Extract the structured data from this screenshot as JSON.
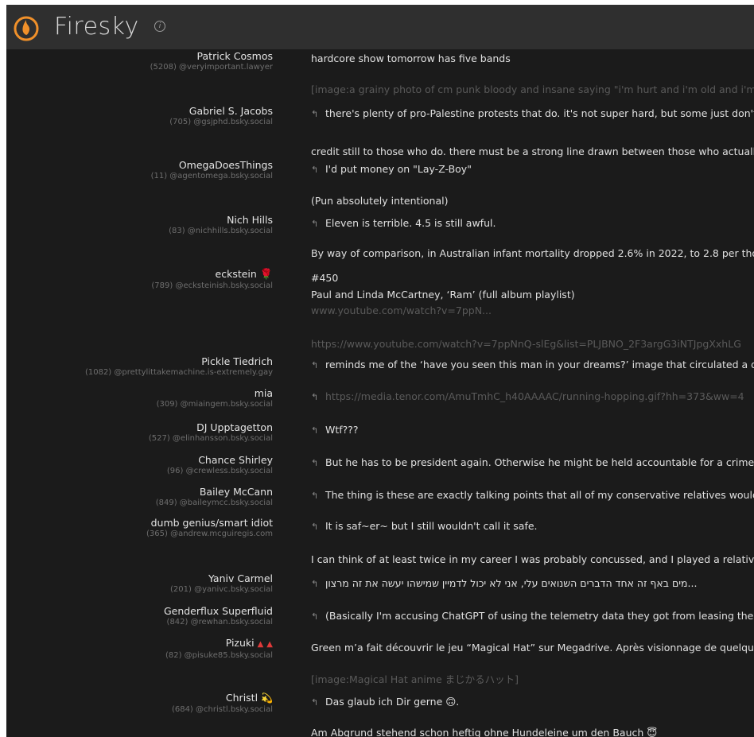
{
  "app": {
    "title": "Firesky",
    "info_glyph": "i",
    "brand_color": "#f0902a"
  },
  "feed": [
    {
      "name": "Patrick Cosmos",
      "handle": "(5208) @veryimportant.lawyer",
      "text": "hardcore show tomorrow has five bands",
      "reply": false,
      "dim": false
    },
    {
      "name": "",
      "handle": "",
      "text": "[image:a grainy photo of cm punk bloody and insane saying \"i'm hurt and i'm old and i'm f",
      "reply": false,
      "dim": true
    },
    {
      "name": "Gabriel S. Jacobs",
      "handle": "(705) @gsjphd.bsky.social",
      "text": "there's plenty of pro-Palestine protests that do. it's not super hard, but some just don't",
      "reply": true,
      "dim": false
    },
    {
      "name": "",
      "handle": "",
      "text": "credit still to those who do. there must be a strong line drawn between those who actuall",
      "reply": false,
      "dim": false
    },
    {
      "name": "OmegaDoesThings",
      "handle": "(11) @agentomega.bsky.social",
      "text": "I'd put money on \"Lay-Z-Boy\"",
      "reply": true,
      "dim": false
    },
    {
      "name": "",
      "handle": "",
      "text": "(Pun absolutely intentional)",
      "reply": false,
      "dim": false
    },
    {
      "name": "Nich Hills",
      "handle": "(83) @nichhills.bsky.social",
      "text": "Eleven is terrible. 4.5 is still awful.",
      "reply": true,
      "dim": false
    },
    {
      "name": "",
      "handle": "",
      "text": "By way of comparison, in Australian infant mortality dropped 2.6% in 2022, to 2.8 per tho",
      "reply": false,
      "dim": false
    },
    {
      "name": "eckstein",
      "handle": "(789) @ecksteinish.bsky.social",
      "text": "#450",
      "reply": false,
      "dim": false
    },
    {
      "name": "",
      "handle": "",
      "text": "Paul and Linda McCartney, ‘Ram’ (full album playlist)",
      "reply": false,
      "dim": false
    },
    {
      "name": "",
      "handle": "",
      "text": "www.youtube.com/watch?v=7ppN...",
      "reply": false,
      "dim": true
    },
    {
      "name": "",
      "handle": "",
      "text": "https://www.youtube.com/watch?v=7ppNnQ-slEg&list=PLJBNO_2F3argG3iNTJpgXxhLG",
      "reply": false,
      "dim": true
    },
    {
      "name": "Pickle Tiedrich",
      "handle": "(1082) @prettylittakemachine.is-extremely.gay",
      "text": "reminds me of the ‘have you seen this man in your dreams?’ image that circulated a de",
      "reply": true,
      "dim": false
    },
    {
      "name": "mia",
      "handle": "(309) @miaingem.bsky.social",
      "text": "https://media.tenor.com/AmuTmhC_h40AAAAC/running-hopping.gif?hh=373&ww=4",
      "reply": true,
      "dim": true
    },
    {
      "name": "DJ Upptagetton",
      "handle": "(527) @elinhansson.bsky.social",
      "text": "Wtf???",
      "reply": true,
      "dim": false
    },
    {
      "name": "Chance Shirley",
      "handle": "(96) @crewless.bsky.social",
      "text": "But he has to be president again. Otherwise he might be held accountable for a crime",
      "reply": true,
      "dim": false
    },
    {
      "name": "Bailey McCann",
      "handle": "(849) @baileymcc.bsky.social",
      "text": "The thing is these are exactly talking points that all of my conservative relatives would",
      "reply": true,
      "dim": false
    },
    {
      "name": "dumb genius/smart idiot",
      "handle": "(365) @andrew.mcguiregis.com",
      "text": "It is saf~er~ but I still wouldn't call it safe.",
      "reply": true,
      "dim": false
    },
    {
      "name": "",
      "handle": "",
      "text": "I can think of at least twice in my career I was probably concussed, and I played a relativel",
      "reply": false,
      "dim": false
    },
    {
      "name": "Yaniv Carmel",
      "handle": "(201) @yanivc.bsky.social",
      "text": "מים באף זה אחד הדברים השנואים עלי, אני לא יכול לדמיין שמישהו יעשה את זה מרצון...",
      "reply": true,
      "dim": false
    },
    {
      "name": "Genderflux Superfluid",
      "handle": "(842) @rewhan.bsky.social",
      "text": "(Basically I'm accusing ChatGPT of using the telemetry data they got from leasing thei",
      "reply": true,
      "dim": false
    },
    {
      "name": "Pizuki",
      "handle": "(82) @pisuke85.bsky.social",
      "text": "Green m’a fait découvrir le jeu “Magical Hat” sur Megadrive. Après visionnage de quelque",
      "reply": false,
      "dim": false
    },
    {
      "name": "",
      "handle": "",
      "text": "[image:Magical Hat anime まじかるハット]",
      "reply": false,
      "dim": true
    },
    {
      "name": "Christl",
      "handle": "(684) @christl.bsky.social",
      "text": "Das glaub ich Dir gerne 🙃.",
      "reply": true,
      "dim": false
    },
    {
      "name": "",
      "handle": "",
      "text": "Am Abgrund stehend schon heftig ohne Hundeleine um den Bauch 😇",
      "reply": false,
      "dim": false
    }
  ],
  "glyphs": {
    "reply": "↰",
    "rose": "🌹",
    "tri1": "▲",
    "tri2": "▲",
    "dizzy": "💫"
  }
}
